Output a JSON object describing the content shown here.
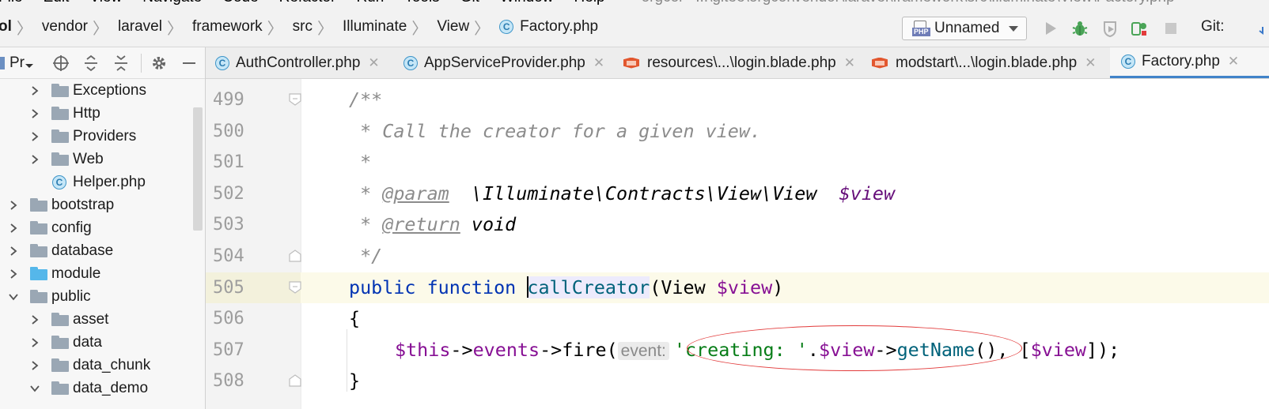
{
  "menu": {
    "items": [
      "File",
      "Edit",
      "View",
      "Navigate",
      "Code",
      "Refactor",
      "Run",
      "Tools",
      "Git",
      "Window",
      "Help"
    ],
    "window_title": "orgcol - ...\\gitee\\orgcol\\vendor\\laravel\\framework\\src\\Illuminate\\View\\Factory.php"
  },
  "breadcrumb": {
    "items": [
      "ol",
      "vendor",
      "laravel",
      "framework",
      "src",
      "Illuminate",
      "View"
    ],
    "file": "Factory.php",
    "file_badge": "C"
  },
  "toolbar": {
    "run_config": "Unnamed",
    "run_config_icon_text": "PHP",
    "git_label": "Git:"
  },
  "project_panel": {
    "title": "Pr",
    "tree": [
      {
        "label": "Exceptions",
        "type": "folder",
        "state": "collapsed"
      },
      {
        "label": "Http",
        "type": "folder",
        "state": "collapsed"
      },
      {
        "label": "Providers",
        "type": "folder",
        "state": "collapsed"
      },
      {
        "label": "Web",
        "type": "folder",
        "state": "collapsed"
      },
      {
        "label": "Helper.php",
        "type": "php-class",
        "badge": "C"
      },
      {
        "label": "bootstrap",
        "type": "folder",
        "state": "collapsed"
      },
      {
        "label": "config",
        "type": "folder",
        "state": "collapsed"
      },
      {
        "label": "database",
        "type": "folder",
        "state": "collapsed"
      },
      {
        "label": "module",
        "type": "module-folder",
        "state": "collapsed"
      },
      {
        "label": "public",
        "type": "folder",
        "state": "expanded"
      },
      {
        "label": "asset",
        "type": "folder",
        "state": "collapsed"
      },
      {
        "label": "data",
        "type": "folder",
        "state": "collapsed"
      },
      {
        "label": "data_chunk",
        "type": "folder",
        "state": "collapsed"
      },
      {
        "label": "data_demo",
        "type": "folder",
        "state": "expanded"
      }
    ]
  },
  "tabs": [
    {
      "label": "AuthController.php",
      "icon": "php-class-icon",
      "badge": "C",
      "active": false
    },
    {
      "label": "AppServiceProvider.php",
      "icon": "php-class-icon",
      "badge": "C",
      "active": false
    },
    {
      "label": "resources\\...\\login.blade.php",
      "icon": "blade-icon",
      "active": false
    },
    {
      "label": "modstart\\...\\login.blade.php",
      "icon": "blade-icon",
      "active": false
    },
    {
      "label": "Factory.php",
      "icon": "php-class-icon",
      "badge": "C",
      "active": true
    }
  ],
  "tab_close": "✕",
  "editor": {
    "line_numbers": [
      "499",
      "500",
      "501",
      "502",
      "503",
      "504",
      "505",
      "506",
      "507",
      "508"
    ],
    "current_line": "505",
    "l499": "/**",
    "l500": " * Call the creator for a given view.",
    "l501": " *",
    "l502": {
      "star": " * ",
      "tag": "@param",
      "gap": "  ",
      "type": "\\Illuminate\\Contracts\\View\\View",
      "gap2": "  ",
      "var": "$view"
    },
    "l503": {
      "star": " * ",
      "tag": "@return",
      "gap": " ",
      "type": "void"
    },
    "l504": " */",
    "l505": {
      "kw1": "public",
      "kw2": "function",
      "name": "callCreator",
      "open": "(View ",
      "var": "$view",
      "close": ")"
    },
    "l506": "{",
    "l507": {
      "this": "$this",
      "arrow1": "->",
      "prop": "events",
      "arrow2": "->fire(",
      "hint": "event:",
      "str": "'creating: '",
      "dot": ".",
      "var": "$view",
      "arrow3": "->",
      "meth": "getName",
      "rest1": "(), [",
      "var2": "$view",
      "rest2": "]);"
    },
    "l508": "}"
  },
  "colors": {
    "keyword": "#0033b3",
    "variable": "#871094",
    "string": "#067d17",
    "method": "#00627a",
    "comment": "#8c8c8c",
    "annotation_oval": "#e23c3c",
    "active_tab_underline": "#4083c9"
  }
}
